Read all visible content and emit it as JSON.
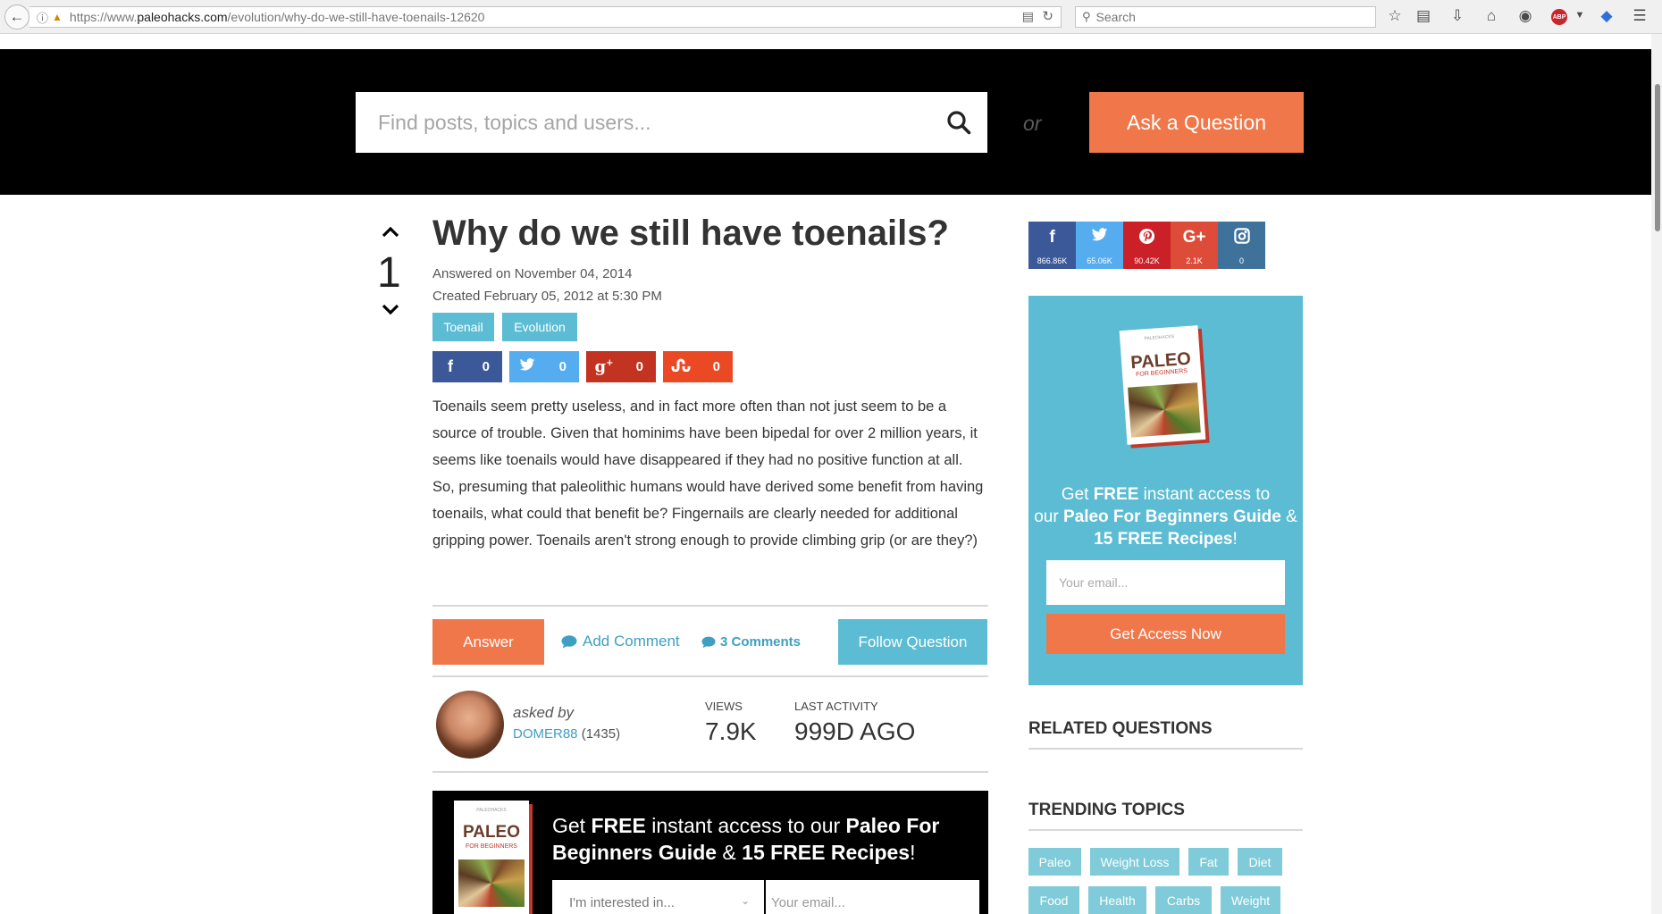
{
  "browser": {
    "url_prefix": "https://www.",
    "url_domain": "paleohacks.com",
    "url_path": "/evolution/why-do-we-still-have-toenails-12620",
    "search_placeholder": "Search"
  },
  "header": {
    "search_placeholder": "Find posts, topics and users...",
    "or_text": "or",
    "ask_label": "Ask a Question"
  },
  "post": {
    "vote_count": "1",
    "title": "Why do we still have toenails?",
    "answered": "Answered on November 04, 2014",
    "created": "Created February 05, 2012 at 5:30 PM",
    "tags": [
      "Toenail",
      "Evolution"
    ],
    "shares": {
      "facebook": {
        "icon": "f",
        "count": "0",
        "color": "#3b5998"
      },
      "twitter": {
        "icon": "t",
        "count": "0",
        "color": "#55acee"
      },
      "googleplus": {
        "icon": "g+",
        "count": "0",
        "color": "#c23321"
      },
      "stumbleupon": {
        "icon": "su",
        "count": "0",
        "color": "#eb4924"
      }
    },
    "body": "Toenails seem pretty useless, and in fact more often than not just seem to be a source of trouble. Given that hominims have been bipedal for over 2 million years, it seems like toenails would have disappeared if they had no positive function at all. So, presuming that paleolithic humans would have derived some benefit from having toenails, what could that benefit be? Fingernails are clearly needed for additional gripping power. Toenails aren't strong enough to provide climbing grip (or are they?)",
    "actions": {
      "answer": "Answer",
      "add_comment": "Add Comment",
      "comments": "3 Comments",
      "follow": "Follow Question"
    },
    "asked_by_label": "asked by",
    "author": "DOMER88",
    "author_rep": "(1435)",
    "views_label": "VIEWS",
    "views": "7.9K",
    "activity_label": "LAST ACTIVITY",
    "activity": "999D AGO"
  },
  "promo": {
    "text_1": "Get ",
    "text_bold_1": "FREE",
    "text_2": " instant access to our ",
    "text_bold_2": "Paleo For Beginners Guide",
    "text_3": " & ",
    "text_bold_3": "15 FREE Recipes",
    "text_4": "!",
    "select_placeholder": "I'm interested in...",
    "email_placeholder": "Your email...",
    "book_brand": "PALEOHACKS",
    "book_title": "PALEO",
    "book_subtitle": "FOR BEGINNERS"
  },
  "sidebar": {
    "social": [
      {
        "icon": "f",
        "count": "866.86K",
        "color": "#3b5998",
        "name": "facebook"
      },
      {
        "icon": "t",
        "count": "65.06K",
        "color": "#55acee",
        "name": "twitter"
      },
      {
        "icon": "p",
        "count": "90.42K",
        "color": "#cb2027",
        "name": "pinterest"
      },
      {
        "icon": "G+",
        "count": "2.1K",
        "color": "#dd4b39",
        "name": "googleplus"
      },
      {
        "icon": "ig",
        "count": "0",
        "color": "#3f729b",
        "name": "instagram"
      }
    ],
    "optin": {
      "line1": "Get ",
      "bold1": "FREE",
      "line1b": " instant access to",
      "line2a": "our ",
      "bold2": "Paleo For Beginners Guide",
      "line2b": " &",
      "bold3": "15 FREE Recipes",
      "line3b": "!",
      "email_placeholder": "Your email...",
      "button": "Get Access Now"
    },
    "related_heading": "RELATED QUESTIONS",
    "trending_heading": "TRENDING TOPICS",
    "topics_row1": [
      "Paleo",
      "Weight Loss",
      "Fat",
      "Diet"
    ],
    "topics_row2": [
      "Food",
      "Health",
      "Carbs",
      "Weight"
    ]
  }
}
